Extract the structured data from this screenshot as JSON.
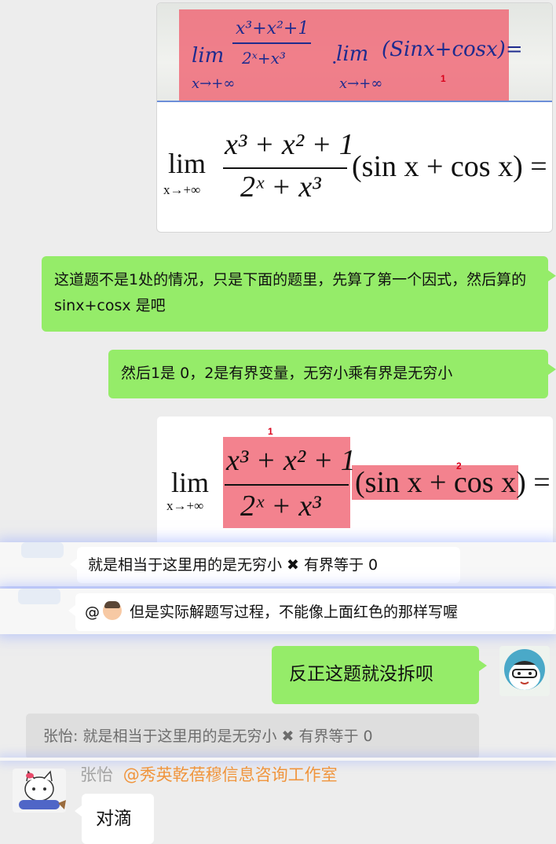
{
  "image1": {
    "handwritten": {
      "lim1": "lim",
      "num": "x³+x²+1",
      "den": "2ˣ+x³",
      "sub1": "x→+∞",
      "dot": "·",
      "lim2": "lim",
      "rest": "(Sinx+cosx)=",
      "sub2": "x→+∞",
      "marker": "1"
    },
    "typeset": {
      "lim": "lim",
      "sub": "x→+∞",
      "num": "x³ + x² + 1",
      "den": "2ˣ + x³",
      "tail": "(sin x + cos x) ="
    }
  },
  "messages": [
    {
      "side": "right",
      "text": "这道题不是1处的情况，只是下面的题里，先算了第一个因式，然后算的 sinx+cosx 是吧"
    },
    {
      "side": "right",
      "text": "然后1是 0，2是有界变量，无穷小乘有界是无穷小"
    }
  ],
  "image2": {
    "lim": "lim",
    "sub": "x→+∞",
    "num": "x³ + x² + 1",
    "den": "2ˣ + x³",
    "tail": "(sin x + cos x) =",
    "marker1": "1",
    "marker2": "2"
  },
  "strip_messages": [
    {
      "text": "就是相当于这里用的是无穷小 ✖ 有界等于 0"
    },
    {
      "mention": "@",
      "text": "但是实际解题写过程，不能像上面红色的那样写喔"
    }
  ],
  "reply": {
    "text": "反正这题就没拆呗",
    "quote": "张怡: 就是相当于这里用的是无穷小 ✖ 有界等于 0"
  },
  "last": {
    "sender": "张怡",
    "group": "@秀英乾蓓穆信息咨询工作室",
    "text": "对滴"
  },
  "colors": {
    "green_bubble": "#95ec69",
    "background": "#ededed",
    "highlight": "#f05f6e",
    "sender_name": "#a3a3a3",
    "group_tag": "#f0953d"
  }
}
